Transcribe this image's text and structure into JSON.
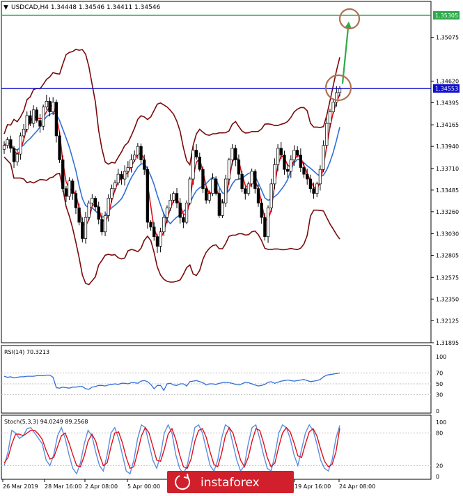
{
  "header": {
    "symbol_line": "USDCAD,H4 1.34448 1.34546 1.34411 1.34546"
  },
  "price_axis": {
    "ticks": [
      "1.35305",
      "1.35075",
      "1.34620",
      "1.34553",
      "1.34395",
      "1.34165",
      "1.33940",
      "1.33710",
      "1.33485",
      "1.33260",
      "1.33030",
      "1.32805",
      "1.32575",
      "1.32350",
      "1.32125",
      "1.31895"
    ]
  },
  "levels": {
    "green_label": "1.35305",
    "blue_label": "1.34553",
    "green_color": "#2eaa4a",
    "blue_color": "#1010d0"
  },
  "rsi": {
    "title": "RSI(14) 70.3213",
    "axis_labels": [
      "100",
      "70",
      "50",
      "30",
      "0"
    ]
  },
  "stoch": {
    "title": "Stoch(5,3,3) 94.0249 89.2568",
    "axis_labels": [
      "100",
      "80",
      "20",
      "0"
    ]
  },
  "time_axis": {
    "labels": [
      "26 Mar 2019",
      "28 Mar 16:00",
      "2 Apr 08:00",
      "5 Apr 00:00",
      "19 Apr 16:00",
      "24 Apr 08:00"
    ]
  },
  "watermark": {
    "text": "instaforex"
  },
  "chart_data": {
    "type": "candlestick",
    "symbol": "USDCAD",
    "timeframe": "H4",
    "ohlc_last": {
      "open": 1.34448,
      "high": 1.34546,
      "low": 1.34411,
      "close": 1.34546
    },
    "ylim": [
      1.31895,
      1.35305
    ],
    "horizontal_levels": [
      1.35305,
      1.34553
    ],
    "close_series": [
      1.3395,
      1.3401,
      1.3392,
      1.3378,
      1.3386,
      1.3405,
      1.3412,
      1.3426,
      1.3418,
      1.3432,
      1.3421,
      1.3415,
      1.3435,
      1.3441,
      1.343,
      1.344,
      1.3405,
      1.338,
      1.335,
      1.3342,
      1.3358,
      1.3345,
      1.333,
      1.3315,
      1.3298,
      1.332,
      1.3335,
      1.334,
      1.3331,
      1.3318,
      1.3305,
      1.3322,
      1.334,
      1.335,
      1.3356,
      1.3365,
      1.336,
      1.3368,
      1.3372,
      1.338,
      1.3385,
      1.3394,
      1.338,
      1.337,
      1.3315,
      1.331,
      1.33,
      1.329,
      1.3305,
      1.332,
      1.333,
      1.3338,
      1.3345,
      1.3335,
      1.332,
      1.3315,
      1.3335,
      1.336,
      1.339,
      1.3383,
      1.337,
      1.335,
      1.3338,
      1.3345,
      1.336,
      1.3345,
      1.3322,
      1.3335,
      1.336,
      1.338,
      1.3392,
      1.338,
      1.3365,
      1.335,
      1.3345,
      1.3355,
      1.3368,
      1.335,
      1.3335,
      1.332,
      1.33,
      1.333,
      1.3355,
      1.3375,
      1.3392,
      1.3385,
      1.337,
      1.3368,
      1.338,
      1.339,
      1.3385,
      1.3372,
      1.3365,
      1.336,
      1.335,
      1.3345,
      1.3355,
      1.337,
      1.3395,
      1.3418,
      1.343,
      1.344,
      1.345,
      1.34546
    ],
    "rsi_series": [
      64,
      62,
      63,
      61,
      62,
      63,
      63,
      64,
      64,
      64,
      65,
      65,
      65,
      66,
      66,
      62,
      43,
      42,
      44,
      43,
      42,
      44,
      44,
      45,
      45,
      41,
      40,
      44,
      45,
      47,
      47,
      46,
      48,
      49,
      50,
      49,
      51,
      51,
      50,
      52,
      52,
      51,
      55,
      56,
      54,
      49,
      41,
      47,
      47,
      38,
      50,
      51,
      48,
      47,
      50,
      50,
      46,
      54,
      55,
      56,
      54,
      52,
      48,
      50,
      50,
      49,
      51,
      52,
      53,
      52,
      51,
      49,
      48,
      50,
      53,
      52,
      50,
      48,
      46,
      47,
      49,
      53,
      54,
      51,
      53,
      55,
      56,
      57,
      56,
      55,
      56,
      57,
      58,
      56,
      54,
      55,
      56,
      58,
      63,
      66,
      67,
      68,
      69,
      70
    ],
    "stoch_main": [
      20,
      45,
      85,
      80,
      70,
      75,
      88,
      90,
      80,
      70,
      60,
      30,
      20,
      40,
      75,
      90,
      70,
      40,
      15,
      5,
      25,
      60,
      85,
      75,
      45,
      20,
      10,
      40,
      80,
      90,
      70,
      40,
      10,
      5,
      30,
      70,
      95,
      90,
      60,
      30,
      15,
      40,
      80,
      95,
      80,
      40,
      15,
      5,
      20,
      55,
      90,
      95,
      80,
      50,
      20,
      10,
      30,
      70,
      95,
      90,
      60,
      30,
      10,
      20,
      60,
      90,
      95,
      70,
      40,
      15,
      10,
      40,
      80,
      95,
      90,
      70,
      40,
      20,
      50,
      80,
      95,
      85,
      60,
      30,
      15,
      10,
      30,
      70,
      94
    ],
    "stoch_signal": [
      25,
      35,
      60,
      78,
      78,
      75,
      80,
      85,
      85,
      78,
      68,
      48,
      32,
      35,
      55,
      75,
      80,
      62,
      40,
      20,
      18,
      38,
      65,
      78,
      65,
      40,
      20,
      25,
      55,
      80,
      82,
      62,
      35,
      15,
      18,
      45,
      75,
      90,
      80,
      55,
      30,
      28,
      50,
      78,
      88,
      68,
      40,
      18,
      15,
      32,
      65,
      85,
      88,
      72,
      45,
      22,
      18,
      42,
      75,
      90,
      80,
      55,
      30,
      18,
      35,
      65,
      88,
      85,
      62,
      35,
      18,
      25,
      55,
      80,
      90,
      82,
      62,
      38,
      35,
      60,
      82,
      88,
      75,
      50,
      28,
      18,
      22,
      45,
      89
    ]
  }
}
